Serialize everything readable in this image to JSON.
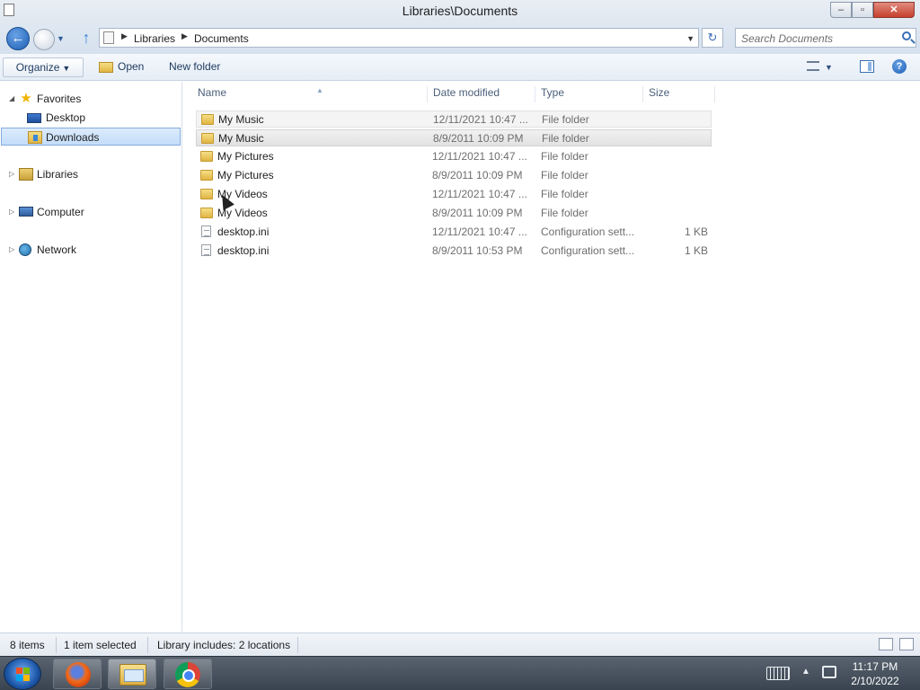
{
  "window": {
    "title": "Libraries\\Documents",
    "minimize_label": "–",
    "maximize_label": "▫",
    "close_label": "✕"
  },
  "nav": {
    "back_symbol": "←",
    "up_symbol": "↑",
    "refresh_symbol": "↻",
    "breadcrumbs": [
      "Libraries",
      "Documents"
    ],
    "search_placeholder": "Search Documents"
  },
  "toolbar": {
    "organize_label": "Organize",
    "open_label": "Open",
    "new_folder_label": "New folder",
    "help_label": "?"
  },
  "sidebar": {
    "favorites": "Favorites",
    "favorite_items": [
      "Desktop",
      "Downloads"
    ],
    "libraries": "Libraries",
    "computer": "Computer",
    "network": "Network"
  },
  "columns": {
    "name": "Name",
    "date": "Date modified",
    "type": "Type",
    "size": "Size"
  },
  "files": [
    {
      "name": "My Music",
      "date": "12/11/2021 10:47 ...",
      "type": "File folder",
      "size": "",
      "kind": "folder-icon",
      "state": "hover"
    },
    {
      "name": "My Music",
      "date": "8/9/2011 10:09 PM",
      "type": "File folder",
      "size": "",
      "kind": "folder-icon",
      "state": "selected"
    },
    {
      "name": "My Pictures",
      "date": "12/11/2021 10:47 ...",
      "type": "File folder",
      "size": "",
      "kind": "folder-icon",
      "state": ""
    },
    {
      "name": "My Pictures",
      "date": "8/9/2011 10:09 PM",
      "type": "File folder",
      "size": "",
      "kind": "folder-icon",
      "state": ""
    },
    {
      "name": "My Videos",
      "date": "12/11/2021 10:47 ...",
      "type": "File folder",
      "size": "",
      "kind": "folder-icon",
      "state": ""
    },
    {
      "name": "My Videos",
      "date": "8/9/2011 10:09 PM",
      "type": "File folder",
      "size": "",
      "kind": "folder-icon",
      "state": ""
    },
    {
      "name": "desktop.ini",
      "date": "12/11/2021 10:47 ...",
      "type": "Configuration sett...",
      "size": "1 KB",
      "kind": "file-icon",
      "state": ""
    },
    {
      "name": "desktop.ini",
      "date": "8/9/2011 10:53 PM",
      "type": "Configuration sett...",
      "size": "1 KB",
      "kind": "file-icon",
      "state": ""
    }
  ],
  "status": {
    "items": "8 items",
    "selected": "1 item selected",
    "library": "Library includes: 2 locations"
  },
  "taskbar": {
    "time": "11:17 PM",
    "date": "2/10/2022"
  }
}
